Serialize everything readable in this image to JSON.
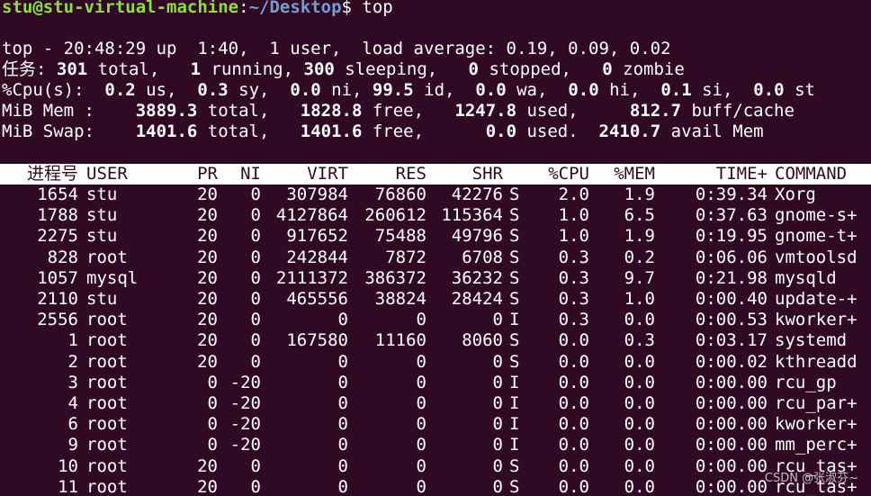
{
  "prompt": {
    "user_host": "stu@stu-virtual-machine",
    "sep": ":",
    "path": "~/Desktop",
    "symbol": "$",
    "command": " top"
  },
  "summary": {
    "line1": "top - 20:48:29 up  1:40,  1 user,  load average: 0.19, 0.09, 0.02",
    "tasks": {
      "label": "任务:",
      "total": "301",
      "total_l": " total,",
      "running": "1",
      "running_l": " running,",
      "sleeping": "300",
      "sleeping_l": " sleeping,",
      "stopped": "0",
      "stopped_l": " stopped,",
      "zombie": "0",
      "zombie_l": " zombie"
    },
    "cpu": {
      "label": "%Cpu(s):",
      "us": "0.2",
      "us_l": " us,",
      "sy": "0.3",
      "sy_l": " sy,",
      "ni": "0.0",
      "ni_l": " ni,",
      "id": "99.5",
      "id_l": " id,",
      "wa": "0.0",
      "wa_l": " wa,",
      "hi": "0.0",
      "hi_l": " hi,",
      "si": "0.1",
      "si_l": " si,",
      "st": "0.0",
      "st_l": " st"
    },
    "mem": {
      "label": "MiB Mem :",
      "total": "3889.3",
      "total_l": " total,",
      "free": "1828.8",
      "free_l": " free,",
      "used": "1247.8",
      "used_l": " used,",
      "buff": "812.7",
      "buff_l": " buff/cache"
    },
    "swap": {
      "label": "MiB Swap:",
      "total": "1401.6",
      "total_l": " total,",
      "free": "1401.6",
      "free_l": " free,",
      "used": "0.0",
      "used_l": " used.",
      "avail": "2410.7",
      "avail_l": " avail Mem"
    }
  },
  "columns": {
    "pid": "进程号",
    "user": "USER",
    "pr": "PR",
    "ni": "NI",
    "virt": "VIRT",
    "res": "RES",
    "shr": "SHR",
    "s": "",
    "cpu": "%CPU",
    "mem": "%MEM",
    "time": "TIME+",
    "cmd": "COMMAND"
  },
  "processes": [
    {
      "pid": "1654",
      "user": "stu",
      "pr": "20",
      "ni": "0",
      "virt": "307984",
      "res": "76860",
      "shr": "42276",
      "s": "S",
      "cpu": "2.0",
      "mem": "1.9",
      "time": "0:39.34",
      "cmd": "Xorg"
    },
    {
      "pid": "1788",
      "user": "stu",
      "pr": "20",
      "ni": "0",
      "virt": "4127864",
      "res": "260612",
      "shr": "115364",
      "s": "S",
      "cpu": "1.0",
      "mem": "6.5",
      "time": "0:37.63",
      "cmd": "gnome-s+"
    },
    {
      "pid": "2275",
      "user": "stu",
      "pr": "20",
      "ni": "0",
      "virt": "917652",
      "res": "75488",
      "shr": "49796",
      "s": "S",
      "cpu": "1.0",
      "mem": "1.9",
      "time": "0:19.95",
      "cmd": "gnome-t+"
    },
    {
      "pid": "828",
      "user": "root",
      "pr": "20",
      "ni": "0",
      "virt": "242844",
      "res": "7872",
      "shr": "6708",
      "s": "S",
      "cpu": "0.3",
      "mem": "0.2",
      "time": "0:06.06",
      "cmd": "vmtoolsd"
    },
    {
      "pid": "1057",
      "user": "mysql",
      "pr": "20",
      "ni": "0",
      "virt": "2111372",
      "res": "386372",
      "shr": "36232",
      "s": "S",
      "cpu": "0.3",
      "mem": "9.7",
      "time": "0:21.98",
      "cmd": "mysqld"
    },
    {
      "pid": "2110",
      "user": "stu",
      "pr": "20",
      "ni": "0",
      "virt": "465556",
      "res": "38824",
      "shr": "28424",
      "s": "S",
      "cpu": "0.3",
      "mem": "1.0",
      "time": "0:00.40",
      "cmd": "update-+"
    },
    {
      "pid": "2556",
      "user": "root",
      "pr": "20",
      "ni": "0",
      "virt": "0",
      "res": "0",
      "shr": "0",
      "s": "I",
      "cpu": "0.3",
      "mem": "0.0",
      "time": "0:00.53",
      "cmd": "kworker+"
    },
    {
      "pid": "1",
      "user": "root",
      "pr": "20",
      "ni": "0",
      "virt": "167580",
      "res": "11160",
      "shr": "8060",
      "s": "S",
      "cpu": "0.0",
      "mem": "0.3",
      "time": "0:03.17",
      "cmd": "systemd"
    },
    {
      "pid": "2",
      "user": "root",
      "pr": "20",
      "ni": "0",
      "virt": "0",
      "res": "0",
      "shr": "0",
      "s": "S",
      "cpu": "0.0",
      "mem": "0.0",
      "time": "0:00.02",
      "cmd": "kthreadd"
    },
    {
      "pid": "3",
      "user": "root",
      "pr": "0",
      "ni": "-20",
      "virt": "0",
      "res": "0",
      "shr": "0",
      "s": "I",
      "cpu": "0.0",
      "mem": "0.0",
      "time": "0:00.00",
      "cmd": "rcu_gp"
    },
    {
      "pid": "4",
      "user": "root",
      "pr": "0",
      "ni": "-20",
      "virt": "0",
      "res": "0",
      "shr": "0",
      "s": "I",
      "cpu": "0.0",
      "mem": "0.0",
      "time": "0:00.00",
      "cmd": "rcu_par+"
    },
    {
      "pid": "6",
      "user": "root",
      "pr": "0",
      "ni": "-20",
      "virt": "0",
      "res": "0",
      "shr": "0",
      "s": "I",
      "cpu": "0.0",
      "mem": "0.0",
      "time": "0:00.00",
      "cmd": "kworker+"
    },
    {
      "pid": "9",
      "user": "root",
      "pr": "0",
      "ni": "-20",
      "virt": "0",
      "res": "0",
      "shr": "0",
      "s": "I",
      "cpu": "0.0",
      "mem": "0.0",
      "time": "0:00.00",
      "cmd": "mm_perc+"
    },
    {
      "pid": "10",
      "user": "root",
      "pr": "20",
      "ni": "0",
      "virt": "0",
      "res": "0",
      "shr": "0",
      "s": "S",
      "cpu": "0.0",
      "mem": "0.0",
      "time": "0:00.00",
      "cmd": "rcu_tas+"
    },
    {
      "pid": "11",
      "user": "root",
      "pr": "20",
      "ni": "0",
      "virt": "0",
      "res": "0",
      "shr": "0",
      "s": "S",
      "cpu": "0.0",
      "mem": "0.0",
      "time": "0:00.00",
      "cmd": "rcu_tas+"
    }
  ],
  "watermark": "CSDN @张淑芬~"
}
